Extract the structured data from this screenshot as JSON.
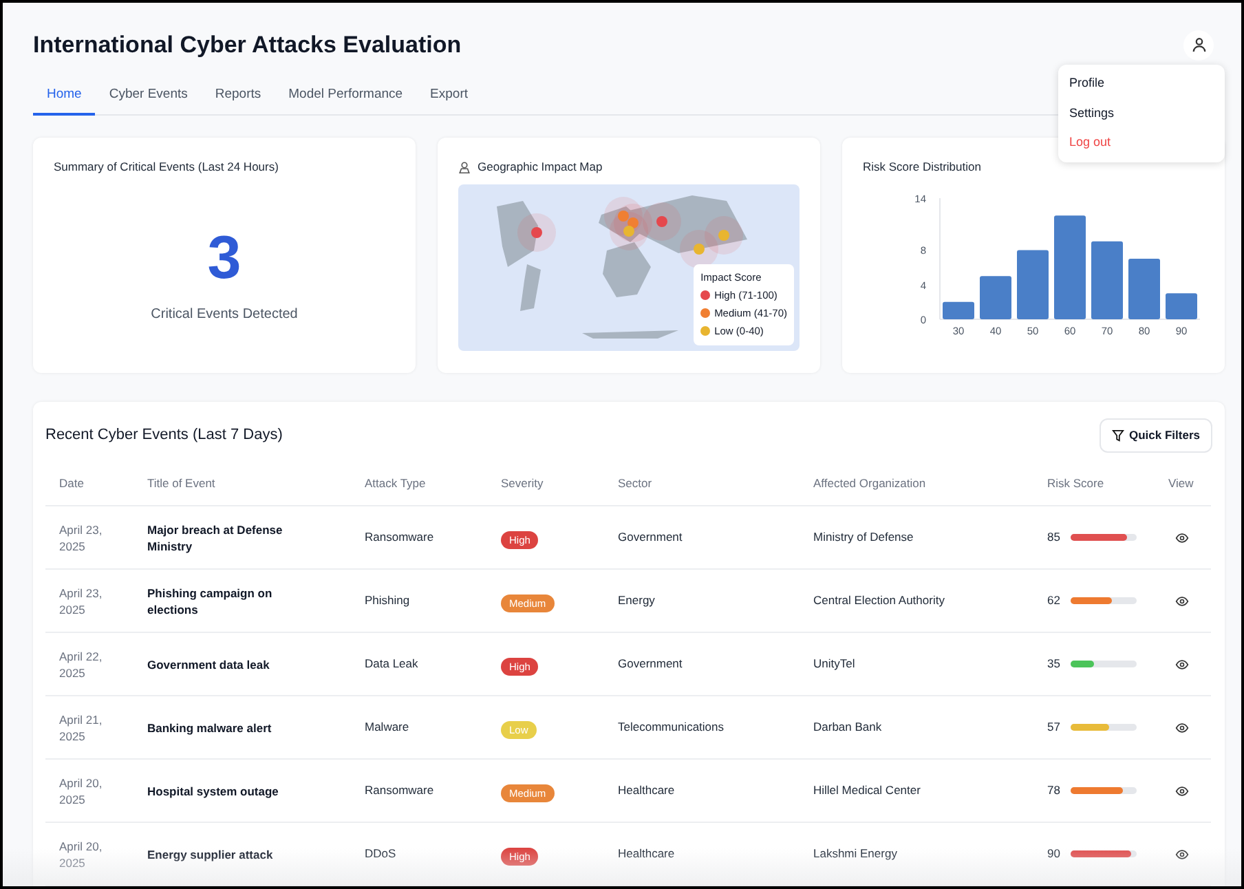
{
  "header": {
    "title": "International Cyber Attacks Evaluation"
  },
  "tabs": [
    {
      "label": "Home",
      "selected": true
    },
    {
      "label": "Cyber Events",
      "selected": false
    },
    {
      "label": "Reports",
      "selected": false
    },
    {
      "label": "Model Performance",
      "selected": false
    },
    {
      "label": "Export",
      "selected": false
    }
  ],
  "user_menu": {
    "expanded": true,
    "items": [
      {
        "label": "Profile",
        "kind": "normal"
      },
      {
        "label": "Settings",
        "kind": "normal"
      },
      {
        "label": "Log out",
        "kind": "danger"
      }
    ]
  },
  "summary_card": {
    "title": "Summary of Critical Events (Last 24 Hours)",
    "count": "3",
    "caption": "Critical Events Detected"
  },
  "map_card": {
    "title": "Geographic Impact Map",
    "legend_title": "Impact Score",
    "legend": [
      {
        "label": "High (71-100)",
        "color": "#e5484d"
      },
      {
        "label": "Medium (41-70)",
        "color": "#f07f32"
      },
      {
        "label": "Low (0-40)",
        "color": "#e8b530"
      }
    ]
  },
  "risk_card": {
    "title": "Risk Score Distribution",
    "chart_data": {
      "type": "bar",
      "categories": [
        "30",
        "40",
        "50",
        "60",
        "70",
        "80",
        "90"
      ],
      "series": [
        {
          "color": "#4a7fc8",
          "values": [
            2,
            5,
            8,
            12,
            9,
            7,
            3
          ]
        }
      ],
      "ylim": [
        0,
        14
      ],
      "yticks": [
        0,
        4,
        8,
        14
      ]
    }
  },
  "events": {
    "title": "Recent Cyber Events (Last 7 Days)",
    "filter_button": "Quick Filters",
    "columns": [
      "Date",
      "Title of Event",
      "Attack Type",
      "Severity",
      "Sector",
      "Affected Organization",
      "Risk Score",
      "View"
    ],
    "rows": [
      {
        "date": "April 23, 2025",
        "title": "Major breach at Defense Ministry",
        "attack_type": "Ransomware",
        "severity": {
          "label": "High",
          "color": "#dc4340"
        },
        "sector": "Government",
        "organization": "Ministry of Defense",
        "risk": {
          "score": "85",
          "level": 0.85,
          "color": "#e05050"
        }
      },
      {
        "date": "April 23, 2025",
        "title": "Phishing campaign on elections",
        "attack_type": "Phishing",
        "severity": {
          "label": "Medium",
          "color": "#e8863a"
        },
        "sector": "Energy",
        "organization": "Central Election Authority",
        "risk": {
          "score": "62",
          "level": 0.62,
          "color": "#ee7a30"
        }
      },
      {
        "date": "April 22, 2025",
        "title": "Government data leak",
        "attack_type": "Data Leak",
        "severity": {
          "label": "High",
          "color": "#dc4340"
        },
        "sector": "Government",
        "organization": "UnityTel",
        "risk": {
          "score": "35",
          "level": 0.35,
          "color": "#4cc45a"
        }
      },
      {
        "date": "April 21, 2025",
        "title": "Banking malware alert",
        "attack_type": "Malware",
        "severity": {
          "label": "Low",
          "color": "#e8cf4a"
        },
        "sector": "Telecommunications",
        "organization": "Darban Bank",
        "risk": {
          "score": "57",
          "level": 0.57,
          "color": "#e8bb3a"
        }
      },
      {
        "date": "April 20, 2025",
        "title": "Hospital system outage",
        "attack_type": "Ransomware",
        "severity": {
          "label": "Medium",
          "color": "#e8863a"
        },
        "sector": "Healthcare",
        "organization": "Hillel Medical Center",
        "risk": {
          "score": "78",
          "level": 0.78,
          "color": "#ee7a30"
        }
      },
      {
        "date": "April 20, 2025",
        "title": "Energy supplier attack",
        "attack_type": "DDoS",
        "severity": {
          "label": "High",
          "color": "#dc4340"
        },
        "sector": "Healthcare",
        "organization": "Lakshmi Energy",
        "risk": {
          "score": "90",
          "level": 0.9,
          "color": "#e05050"
        }
      }
    ]
  }
}
